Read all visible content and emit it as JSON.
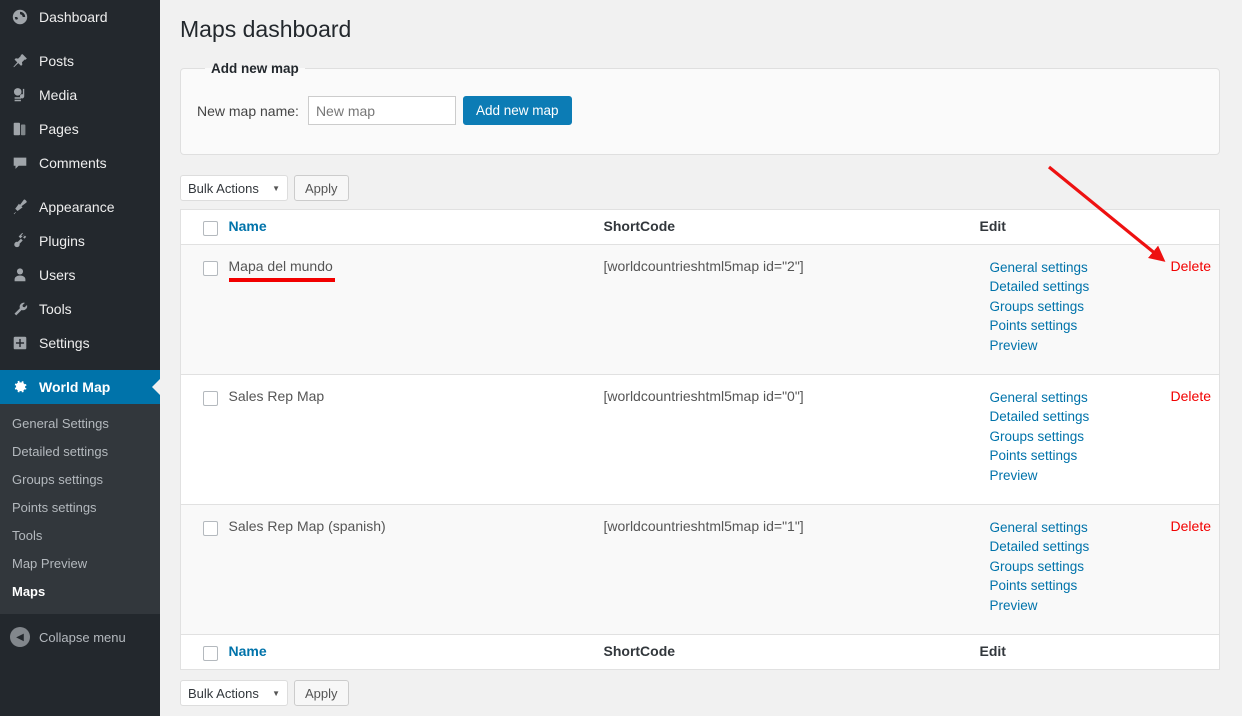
{
  "sidebar": {
    "items": [
      {
        "label": "Dashboard",
        "icon": "dashboard-icon",
        "name": "dashboard"
      },
      {
        "label": "Posts",
        "icon": "pin-icon",
        "name": "posts"
      },
      {
        "label": "Media",
        "icon": "media-icon",
        "name": "media"
      },
      {
        "label": "Pages",
        "icon": "pages-icon",
        "name": "pages"
      },
      {
        "label": "Comments",
        "icon": "comments-icon",
        "name": "comments"
      },
      {
        "label": "Appearance",
        "icon": "brush-icon",
        "name": "appearance"
      },
      {
        "label": "Plugins",
        "icon": "plug-icon",
        "name": "plugins"
      },
      {
        "label": "Users",
        "icon": "user-icon",
        "name": "users"
      },
      {
        "label": "Tools",
        "icon": "wrench-icon",
        "name": "tools"
      },
      {
        "label": "Settings",
        "icon": "sliders-icon",
        "name": "settings"
      }
    ],
    "active": {
      "label": "World Map",
      "icon": "gear-icon"
    },
    "submenu": [
      {
        "label": "General Settings",
        "current": false
      },
      {
        "label": "Detailed settings",
        "current": false
      },
      {
        "label": "Groups settings",
        "current": false
      },
      {
        "label": "Points settings",
        "current": false
      },
      {
        "label": "Tools",
        "current": false
      },
      {
        "label": "Map Preview",
        "current": false
      },
      {
        "label": "Maps",
        "current": true
      }
    ],
    "collapse_label": "Collapse menu",
    "collapse_icon": "chevron-left-icon"
  },
  "page": {
    "title": "Maps dashboard"
  },
  "add_map": {
    "legend": "Add new map",
    "field_label": "New map name:",
    "input_value": "New map",
    "input_placeholder": "New map",
    "button_label": "Add new map"
  },
  "bulk_top": {
    "select_value": "Bulk Actions",
    "caret": "▼",
    "apply_label": "Apply"
  },
  "bulk_bottom": {
    "select_value": "Bulk Actions",
    "caret": "▼",
    "apply_label": "Apply"
  },
  "table": {
    "headers": {
      "name": "Name",
      "shortcode": "ShortCode",
      "edit": "Edit"
    },
    "footers": {
      "name": "Name",
      "shortcode": "ShortCode",
      "edit": "Edit"
    },
    "edit_links": [
      "General settings",
      "Detailed settings",
      "Groups settings",
      "Points settings",
      "Preview"
    ],
    "delete_label": "Delete",
    "rows": [
      {
        "name": "Mapa del mundo",
        "shortcode": "[worldcountrieshtml5map id=\"2\"]",
        "highlighted": true
      },
      {
        "name": "Sales Rep Map",
        "shortcode": "[worldcountrieshtml5map id=\"0\"]",
        "highlighted": false
      },
      {
        "name": "Sales Rep Map (spanish)",
        "shortcode": "[worldcountrieshtml5map id=\"1\"]",
        "highlighted": false
      }
    ]
  },
  "annotation": {
    "arrow_color": "#ee1111",
    "underline_color": "#f20000"
  },
  "colors": {
    "sidebar_bg": "#23282d",
    "submenu_bg": "#32373c",
    "accent_blue": "#0073aa",
    "link_blue": "#0073aa",
    "delete_red": "#f20000",
    "page_bg": "#f1f1f1"
  }
}
